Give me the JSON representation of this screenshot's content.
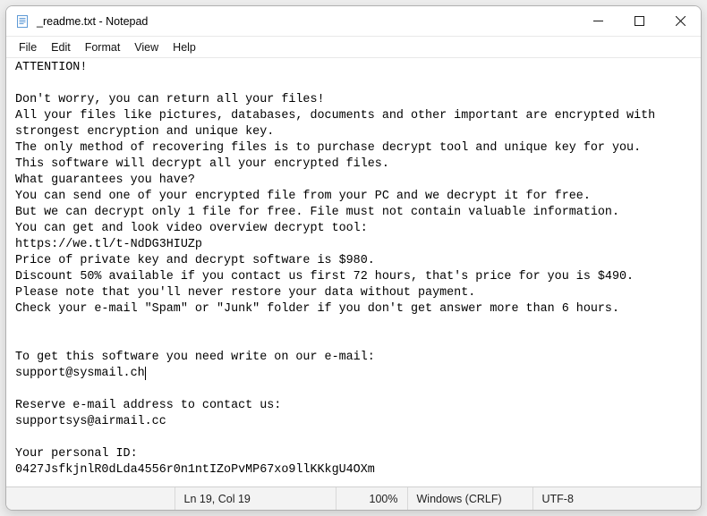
{
  "window": {
    "title": "_readme.txt - Notepad"
  },
  "menubar": {
    "file": "File",
    "edit": "Edit",
    "format": "Format",
    "view": "View",
    "help": "Help"
  },
  "document": {
    "lines": [
      "ATTENTION!",
      "",
      "Don't worry, you can return all your files!",
      "All your files like pictures, databases, documents and other important are encrypted with strongest encryption and unique key.",
      "The only method of recovering files is to purchase decrypt tool and unique key for you.",
      "This software will decrypt all your encrypted files.",
      "What guarantees you have?",
      "You can send one of your encrypted file from your PC and we decrypt it for free.",
      "But we can decrypt only 1 file for free. File must not contain valuable information.",
      "You can get and look video overview decrypt tool:",
      "https://we.tl/t-NdDG3HIUZp",
      "Price of private key and decrypt software is $980.",
      "Discount 50% available if you contact us first 72 hours, that's price for you is $490.",
      "Please note that you'll never restore your data without payment.",
      "Check your e-mail \"Spam\" or \"Junk\" folder if you don't get answer more than 6 hours.",
      "",
      "",
      "To get this software you need write on our e-mail:",
      "support@sysmail.ch",
      "",
      "Reserve e-mail address to contact us:",
      "supportsys@airmail.cc",
      "",
      "Your personal ID:",
      "0427JsfkjnlR0dLda4556r0n1ntIZoPvMP67xo9llKKkgU4OXm"
    ],
    "caret_line_index": 18
  },
  "statusbar": {
    "lncol": "Ln 19, Col 19",
    "zoom": "100%",
    "eol": "Windows (CRLF)",
    "encoding": "UTF-8"
  }
}
